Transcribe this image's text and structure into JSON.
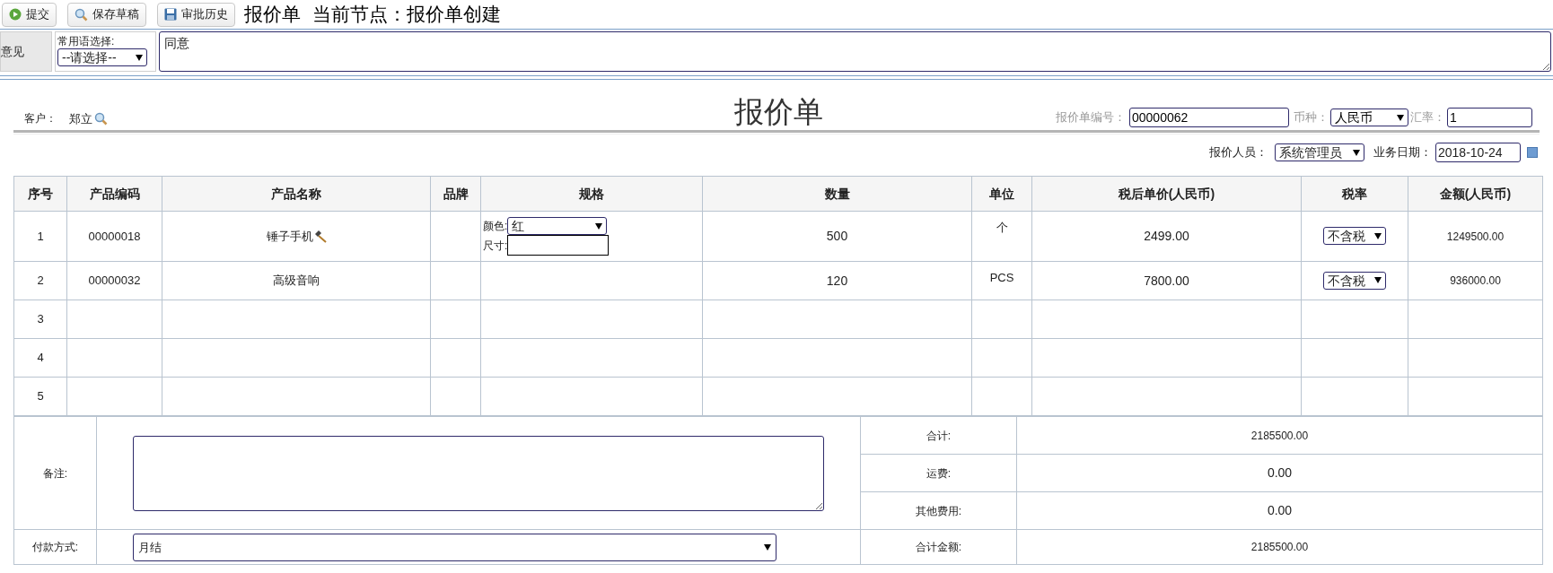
{
  "toolbar": {
    "buttons": [
      {
        "kind": "submit",
        "label": "提交"
      },
      {
        "kind": "save",
        "label": "保存草稿"
      },
      {
        "kind": "history",
        "label": "审批历史"
      }
    ],
    "title": "报价单",
    "node": "当前节点：报价单创建"
  },
  "opinion": {
    "label": "意见",
    "phrase_label": "常用语选择:",
    "phrase_select": "--请选择--",
    "text": "同意"
  },
  "form": {
    "title": "报价单",
    "customer_label": "客户：",
    "customer": "郑立",
    "number_label": "报价单编号：",
    "number": "00000062",
    "currency_label": "币种：",
    "currency": "人民币",
    "rate_label": "汇率：",
    "rate": "1",
    "salesperson_label": "报价人员：",
    "salesperson": "系统管理员",
    "date_label": "业务日期：",
    "date": "2018-10-24"
  },
  "table": {
    "columns": [
      "序号",
      "产品编码",
      "产品名称",
      "品牌",
      "规格",
      "数量",
      "单位",
      "税后单价(人民币)",
      "税率",
      "金额(人民币)"
    ],
    "rows": [
      {
        "kind": "configured",
        "index": "1",
        "code": "00000018",
        "name": "锤子手机",
        "spec": [
          {
            "kind": "select",
            "label": "颜色:",
            "value": "红"
          },
          {
            "kind": "input",
            "label": "尺寸:"
          }
        ],
        "quantity": "500",
        "unit": "个",
        "price": "2499.00",
        "tax": "不含税",
        "amount": "1249500.00"
      },
      {
        "index": "2",
        "code": "00000032",
        "name": "高级音响",
        "quantity": "120",
        "unit": "PCS",
        "price": "7800.00",
        "tax": "不含税",
        "amount": "936000.00"
      },
      {
        "index": "3"
      },
      {
        "index": "4"
      },
      {
        "index": "5"
      }
    ]
  },
  "summary": {
    "remarks_label": "备注:",
    "payment_label": "付款方式:",
    "payment": "月结",
    "totals": [
      {
        "label": "合计:",
        "value": "2185500.00"
      },
      {
        "label": "运费:",
        "value": "0.00"
      },
      {
        "label": "其他费用:",
        "value": "0.00"
      },
      {
        "label": "合计金额:",
        "value": "2185500.00"
      }
    ]
  }
}
